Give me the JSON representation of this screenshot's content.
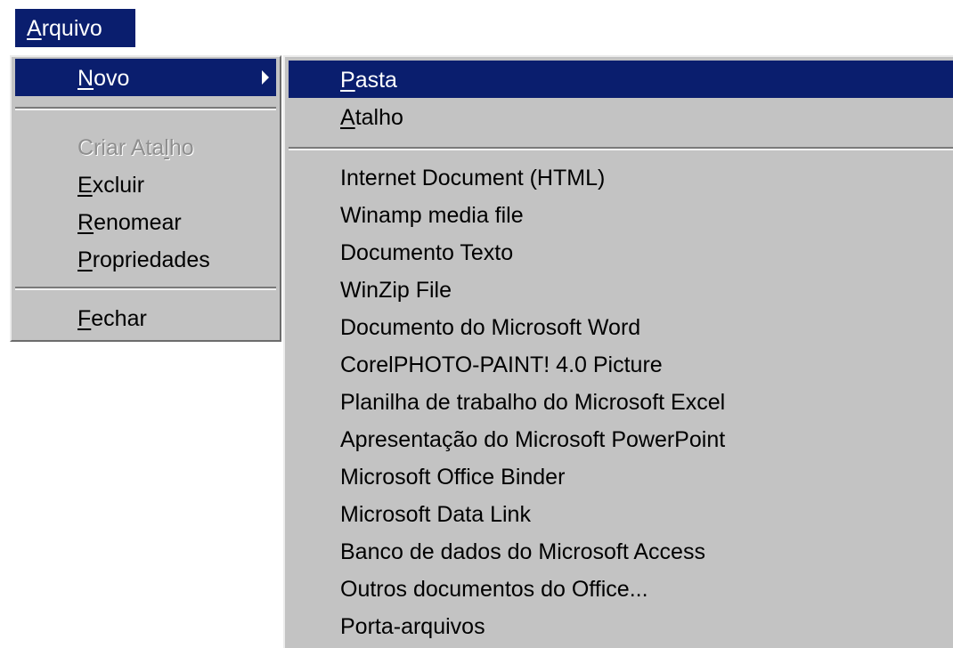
{
  "menubar": {
    "file_menu": {
      "label": "Arquivo"
    }
  },
  "file_menu": {
    "new": {
      "label": "Novo"
    },
    "create_shortcut": {
      "label": "Criar Atalho"
    },
    "delete": {
      "label": "Excluir"
    },
    "rename": {
      "label": "Renomear"
    },
    "properties": {
      "label": "Propriedades"
    },
    "close": {
      "label": "Fechar"
    }
  },
  "submenu": {
    "folder": {
      "label": "Pasta"
    },
    "shortcut": {
      "label": "Atalho"
    },
    "items": [
      "Internet Document (HTML)",
      "Winamp media file",
      "Documento Texto",
      "WinZip File",
      "Documento do Microsoft Word",
      "CorelPHOTO-PAINT! 4.0 Picture",
      "Planilha de trabalho do Microsoft Excel",
      "Apresentação do Microsoft PowerPoint",
      "Microsoft Office Binder",
      "Microsoft Data Link",
      "Banco de dados do Microsoft Access",
      "Outros documentos do Office...",
      "Porta-arquivos"
    ]
  },
  "colors": {
    "highlight": "#0a1e6e",
    "menu_background": "#c3c3c3",
    "disabled_text": "#8f8f8f"
  }
}
